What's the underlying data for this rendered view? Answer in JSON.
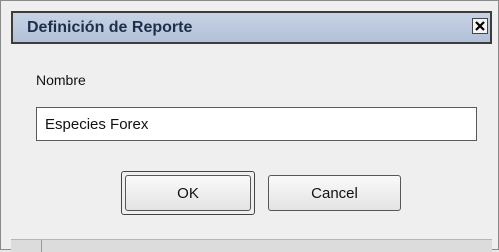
{
  "dialog": {
    "title": "Definición de Reporte",
    "close_icon": "close-icon"
  },
  "form": {
    "name_label": "Nombre",
    "name_value": "Especies Forex"
  },
  "buttons": {
    "ok_label": "OK",
    "cancel_label": "Cancel"
  }
}
